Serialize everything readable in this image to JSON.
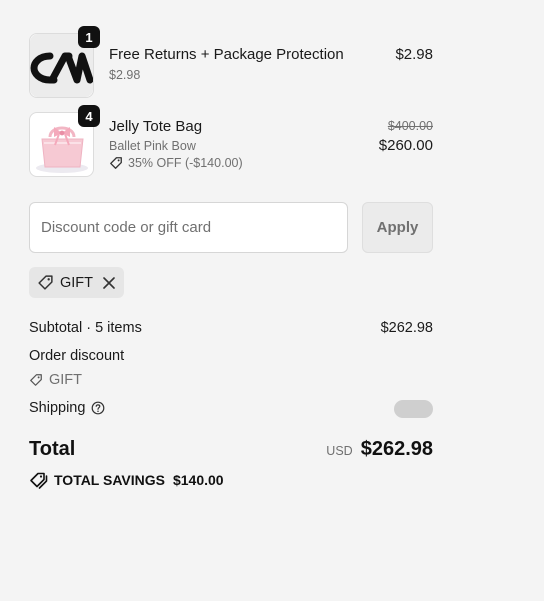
{
  "items": [
    {
      "quantity": "1",
      "name": "Free Returns + Package Protection",
      "subtitle": "$2.98",
      "price": "$2.98",
      "image_icon": "case-mate-logo-icon"
    },
    {
      "quantity": "4",
      "name": "Jelly Tote Bag",
      "subtitle": "Ballet Pink Bow",
      "compare_price": "$400.00",
      "price": "$260.00",
      "discount": "35% OFF (-$140.00)",
      "image_icon": "pink-tote-bag-icon"
    }
  ],
  "discount_form": {
    "placeholder": "Discount code or gift card",
    "value": "",
    "apply_label": "Apply"
  },
  "applied_code": {
    "label": "GIFT"
  },
  "summary": {
    "subtotal_label": "Subtotal · 5 items",
    "subtotal_value": "$262.98",
    "order_discount_label": "Order discount",
    "order_discount_code": "GIFT",
    "shipping_label": "Shipping",
    "total_label": "Total",
    "currency": "USD",
    "total_value": "$262.98",
    "savings_label": "TOTAL SAVINGS",
    "savings_value": "$140.00"
  },
  "colors": {
    "background": "#f4f4f4",
    "text": "#1a1a1a",
    "muted": "#707070",
    "badge": "#111111",
    "chip": "#e6e6e6",
    "tote_pink": "#f6c9d3"
  }
}
